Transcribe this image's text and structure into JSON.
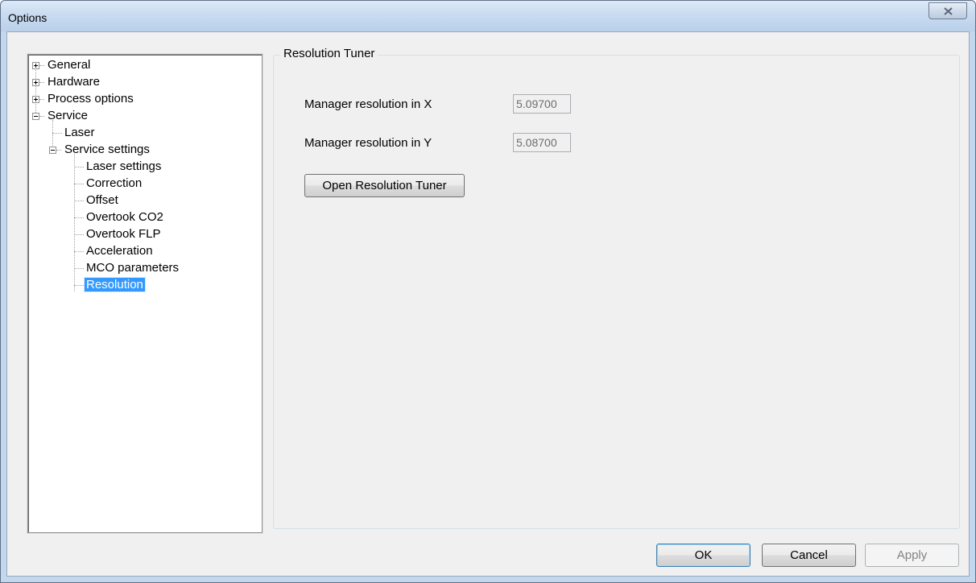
{
  "window": {
    "title": "Options"
  },
  "tree": {
    "items": [
      {
        "label": "General"
      },
      {
        "label": "Hardware"
      },
      {
        "label": "Process options"
      },
      {
        "label": "Service"
      },
      {
        "label": "Laser"
      },
      {
        "label": "Service settings"
      },
      {
        "label": "Laser settings"
      },
      {
        "label": "Correction"
      },
      {
        "label": "Offset"
      },
      {
        "label": "Overtook CO2"
      },
      {
        "label": "Overtook FLP"
      },
      {
        "label": "Acceleration"
      },
      {
        "label": "MCO parameters"
      },
      {
        "label": "Resolution"
      }
    ],
    "selected": "Resolution"
  },
  "panel": {
    "group_title": "Resolution Tuner",
    "res_x_label": "Manager resolution in X",
    "res_x_value": "5.09700",
    "res_y_label": "Manager resolution in Y",
    "res_y_value": "5.08700",
    "open_button": "Open Resolution Tuner"
  },
  "buttons": {
    "ok": "OK",
    "cancel": "Cancel",
    "apply": "Apply"
  }
}
